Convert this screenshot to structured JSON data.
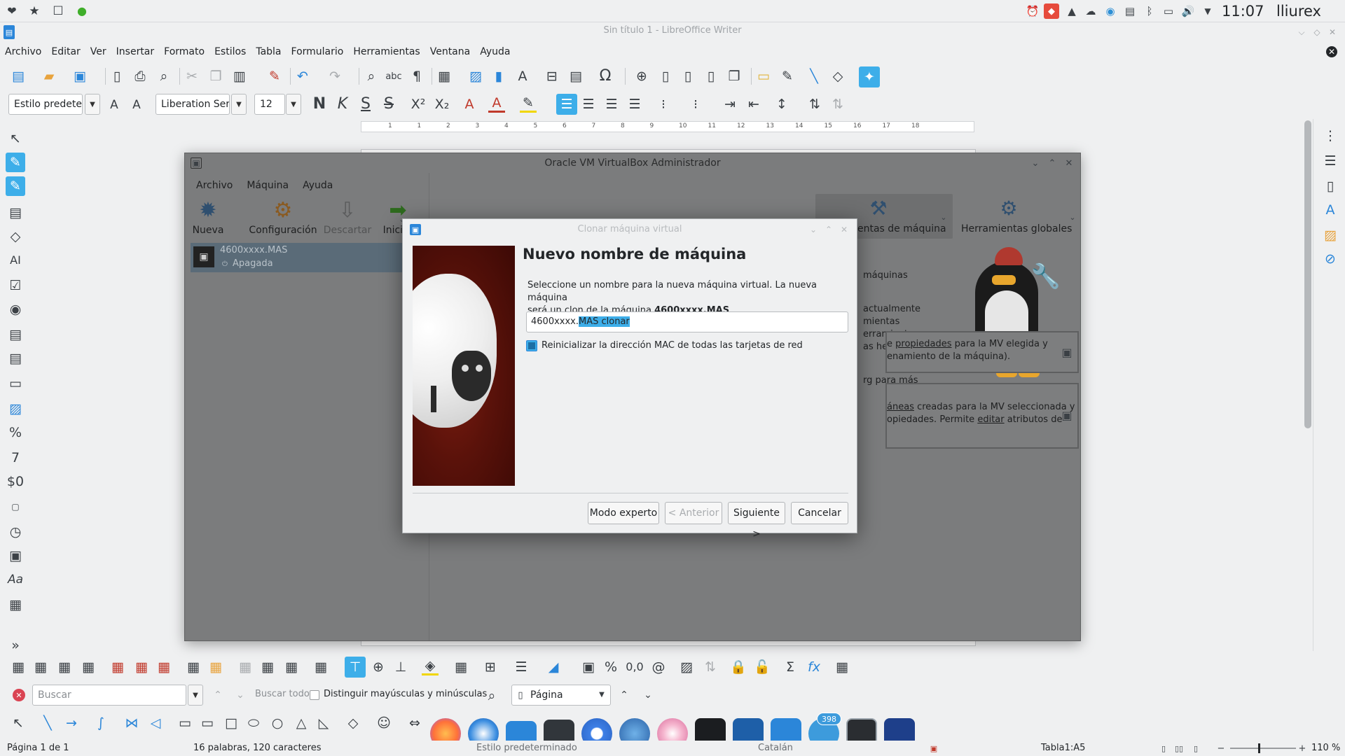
{
  "topbar": {
    "clock": "11:07",
    "user": "lliurex"
  },
  "writer": {
    "title": "Sin título 1 - LibreOffice Writer",
    "menu": [
      "Archivo",
      "Editar",
      "Ver",
      "Insertar",
      "Formato",
      "Estilos",
      "Tabla",
      "Formulario",
      "Herramientas",
      "Ventana",
      "Ayuda"
    ],
    "paragraph_style": "Estilo predetern",
    "font_name": "Liberation Serif",
    "font_size": "12",
    "format_buttons": {
      "bold": "N",
      "italic": "K",
      "underline": "S",
      "strike": "S",
      "superscript": "X²",
      "subscript": "X₂"
    },
    "ruler_numbers": [
      "1",
      "1",
      "2",
      "3",
      "4",
      "5",
      "6",
      "7",
      "8",
      "9",
      "10",
      "11",
      "12",
      "13",
      "14",
      "15",
      "16",
      "17",
      "18"
    ],
    "sidebar_icons": [
      "$0",
      "Aa"
    ],
    "find_bar": {
      "search_placeholder": "Buscar",
      "find_all_label": "Buscar todo",
      "match_case_label": "Distinguir mayúsculas y minúsculas",
      "navigate_by": "Página"
    },
    "status": {
      "page": "Página 1 de 1",
      "words": "16 palabras, 120 caracteres",
      "style": "Estilo predeterminado",
      "language": "Catalán",
      "cell": "Tabla1:A5",
      "zoom": "110 %"
    }
  },
  "vbox": {
    "title": "Oracle VM VirtualBox Administrador",
    "menu": [
      "Archivo",
      "Máquina",
      "Ayuda"
    ],
    "toolbar": [
      "Nueva",
      "Configuración",
      "Descartar",
      "Iniciar"
    ],
    "tools_tabs": [
      "entas de máquina",
      "Herramientas globales"
    ],
    "vm": {
      "name": "4600xxxx.MAS",
      "state": "Apagada"
    },
    "welcome_fragments": [
      "máquinas",
      "actualmente",
      "mientas",
      "erramientas",
      "as herramientas",
      "rg para más"
    ],
    "box1": {
      "pre": "e ",
      "link": "propiedades",
      "post": " para la MV elegida y",
      "line2": "enamiento de la máquina)."
    },
    "box2": {
      "link1": "áneas",
      "mid": " creadas para la MV seleccionada y",
      "line2a": "opiedades. Permite ",
      "link2": "editar",
      "line2b": " atributos de"
    }
  },
  "dialog": {
    "title": "Clonar máquina virtual",
    "heading": "Nuevo nombre de máquina",
    "desc_1": "Seleccione un nombre para la nueva máquina virtual. La nueva máquina",
    "desc_2_pre": "será un clon de la máquina ",
    "desc_2_bold": "4600xxxx.MAS",
    "desc_2_post": ".",
    "name_value_plain": "4600xxxx.",
    "name_value_selected": "MAS clonar",
    "mac_checkbox_label": "Reinicializar la dirección MAC de todas las tarjetas de red",
    "mac_checked": true,
    "buttons": {
      "expert": "Modo experto",
      "back": "< Anterior",
      "next": "Siguiente >",
      "cancel": "Cancelar"
    }
  },
  "dock": {
    "badge": "398"
  },
  "colors": {
    "accent": "#3daee9",
    "selection": "#3daee9",
    "vbox_dim": "#7b7c7d",
    "sheep_bg": "#5a120a"
  }
}
